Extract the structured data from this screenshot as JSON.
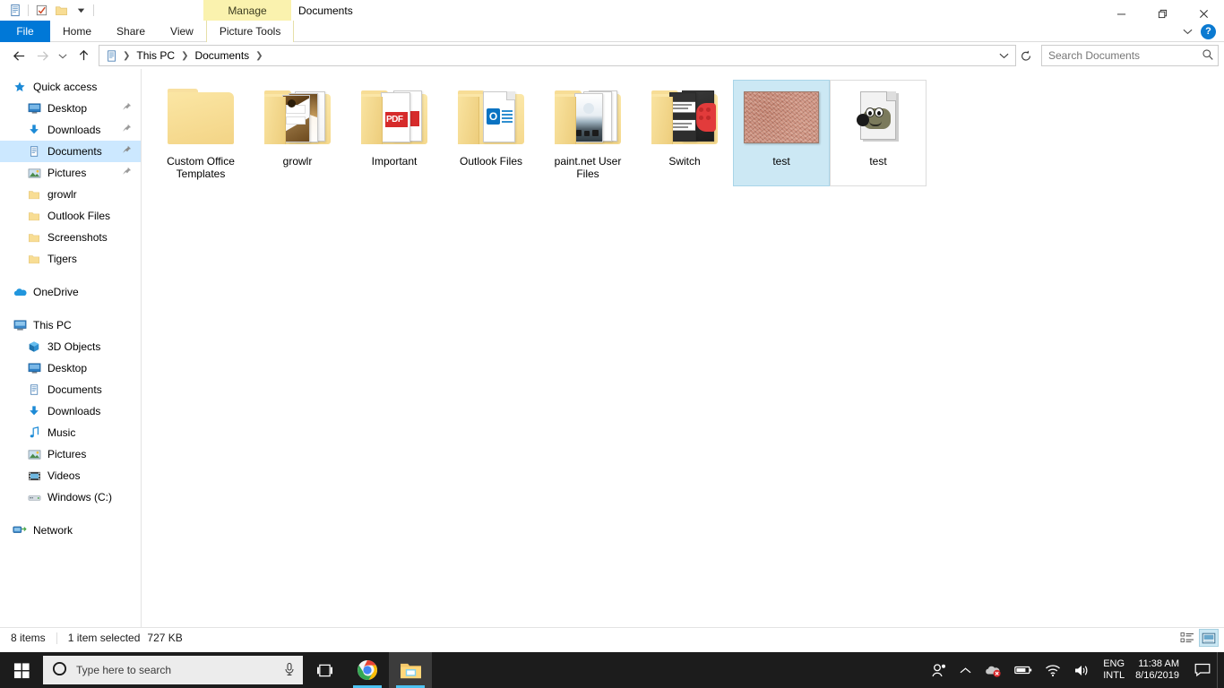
{
  "window": {
    "title": "Documents",
    "contextual_tab_group": "Manage",
    "minimize_label": "Minimize",
    "restore_label": "Restore",
    "close_label": "Close",
    "help_label": "?",
    "ribbon_collapse_label": "Minimize the Ribbon"
  },
  "quick_access_toolbar": {
    "items": [
      {
        "name": "documents-icon",
        "label": "Documents"
      },
      {
        "name": "properties-icon",
        "label": "Properties"
      },
      {
        "name": "new-folder-icon",
        "label": "New folder"
      },
      {
        "name": "customize-dropdown-icon",
        "label": "Customize Quick Access Toolbar"
      }
    ]
  },
  "ribbon": {
    "tabs": [
      {
        "label": "File",
        "selected": false,
        "style": "file"
      },
      {
        "label": "Home",
        "selected": false,
        "style": "normal"
      },
      {
        "label": "Share",
        "selected": false,
        "style": "normal"
      },
      {
        "label": "View",
        "selected": false,
        "style": "normal"
      },
      {
        "label": "Picture Tools",
        "selected": true,
        "style": "context"
      }
    ]
  },
  "address_bar": {
    "back_label": "Back",
    "forward_label": "Forward",
    "recent_label": "Recent locations",
    "up_label": "Up",
    "breadcrumbs": [
      "This PC",
      "Documents"
    ],
    "dropdown_label": "Previous locations",
    "refresh_label": "Refresh"
  },
  "search": {
    "placeholder": "Search Documents",
    "value": ""
  },
  "sidebar": {
    "groups": [
      {
        "header": {
          "label": "Quick access",
          "icon": "star-icon"
        },
        "items": [
          {
            "label": "Desktop",
            "icon": "desktop-icon",
            "pinned": true,
            "selected": false
          },
          {
            "label": "Downloads",
            "icon": "download-icon",
            "pinned": true,
            "selected": false
          },
          {
            "label": "Documents",
            "icon": "documents-icon",
            "pinned": true,
            "selected": true
          },
          {
            "label": "Pictures",
            "icon": "pictures-icon",
            "pinned": true,
            "selected": false
          },
          {
            "label": "growlr",
            "icon": "folder-icon",
            "pinned": false,
            "selected": false
          },
          {
            "label": "Outlook Files",
            "icon": "folder-icon",
            "pinned": false,
            "selected": false
          },
          {
            "label": "Screenshots",
            "icon": "folder-icon",
            "pinned": false,
            "selected": false
          },
          {
            "label": "Tigers",
            "icon": "folder-icon",
            "pinned": false,
            "selected": false
          }
        ]
      },
      {
        "header": {
          "label": "OneDrive",
          "icon": "onedrive-icon"
        },
        "items": []
      },
      {
        "header": {
          "label": "This PC",
          "icon": "thispc-icon"
        },
        "items": [
          {
            "label": "3D Objects",
            "icon": "3dobjects-icon",
            "pinned": false,
            "selected": false
          },
          {
            "label": "Desktop",
            "icon": "desktop-icon",
            "pinned": false,
            "selected": false
          },
          {
            "label": "Documents",
            "icon": "documents-icon",
            "pinned": false,
            "selected": false
          },
          {
            "label": "Downloads",
            "icon": "download-icon",
            "pinned": false,
            "selected": false
          },
          {
            "label": "Music",
            "icon": "music-icon",
            "pinned": false,
            "selected": false
          },
          {
            "label": "Pictures",
            "icon": "pictures-icon",
            "pinned": false,
            "selected": false
          },
          {
            "label": "Videos",
            "icon": "videos-icon",
            "pinned": false,
            "selected": false
          },
          {
            "label": "Windows (C:)",
            "icon": "drive-icon",
            "pinned": false,
            "selected": false
          }
        ]
      },
      {
        "header": {
          "label": "Network",
          "icon": "network-icon"
        },
        "items": []
      }
    ]
  },
  "files": [
    {
      "name": "Custom Office Templates",
      "kind": "folder",
      "thumb": "folder-empty",
      "selected": false
    },
    {
      "name": "growlr",
      "kind": "folder",
      "thumb": "folder-photos",
      "selected": false
    },
    {
      "name": "Important",
      "kind": "folder",
      "thumb": "folder-pdf",
      "selected": false
    },
    {
      "name": "Outlook Files",
      "kind": "folder",
      "thumb": "folder-outlook",
      "selected": false
    },
    {
      "name": "paint.net User Files",
      "kind": "folder",
      "thumb": "folder-paintnet",
      "selected": false
    },
    {
      "name": "Switch",
      "kind": "folder",
      "thumb": "folder-switch",
      "selected": false
    },
    {
      "name": "test",
      "kind": "image",
      "thumb": "texture-thumbnail",
      "selected": true
    },
    {
      "name": "test",
      "kind": "gimp-xcf",
      "thumb": "gimp-file-icon",
      "selected": false
    }
  ],
  "status_bar": {
    "item_count": "8 items",
    "selection": "1 item selected",
    "size": "727 KB",
    "details_view_label": "Details view",
    "large_icons_view_label": "Large icons view"
  },
  "taskbar": {
    "start_label": "Start",
    "search_placeholder": "Type here to search",
    "cortana_label": "Cortana",
    "microphone_label": "Talk to Cortana",
    "task_view_label": "Task View",
    "apps": [
      {
        "name": "chrome",
        "label": "Google Chrome",
        "running": true,
        "active": false
      },
      {
        "name": "file-explorer",
        "label": "File Explorer",
        "running": true,
        "active": true
      }
    ],
    "tray": {
      "people_label": "People",
      "show_hidden_label": "Show hidden icons",
      "onedrive_label": "OneDrive - error",
      "battery_label": "Battery",
      "network_label": "Network",
      "volume_label": "Speakers",
      "language_line1": "ENG",
      "language_line2": "INTL",
      "time": "11:38 AM",
      "date": "8/16/2019",
      "action_center_label": "Action Center",
      "show_desktop_label": "Show desktop"
    }
  },
  "colors": {
    "accent": "#0078d7",
    "selection_bg": "#cce8f4",
    "nav_selection_bg": "#cce8ff",
    "contextual_tab": "#faf2ae",
    "taskbar_bg": "#1c1c1c"
  }
}
